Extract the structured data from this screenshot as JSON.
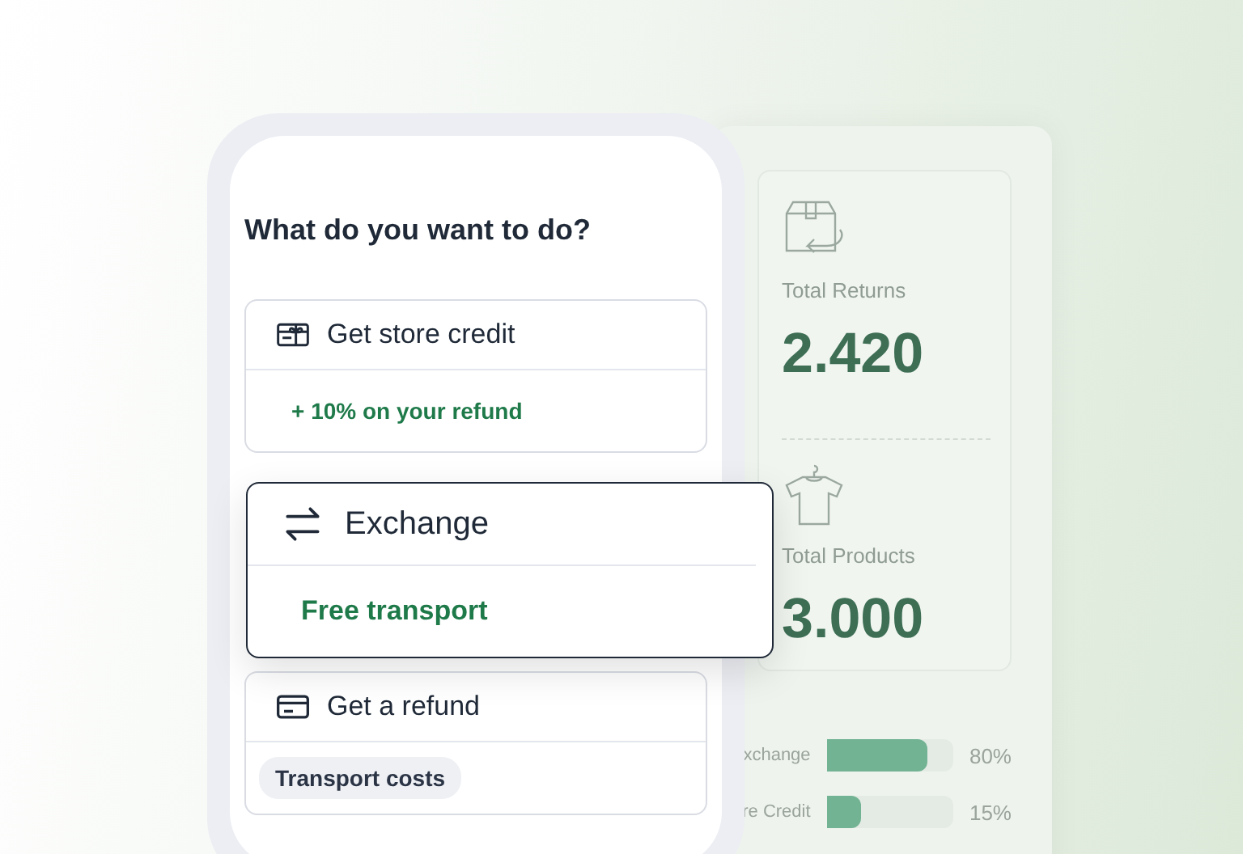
{
  "dashboard": {
    "stats": [
      {
        "kind": "returns",
        "label": "Total Returns",
        "value": "2.420"
      },
      {
        "kind": "products",
        "label": "Total Products",
        "value": "3.000"
      }
    ],
    "breakdown": [
      {
        "label": "xchange",
        "level": 0.8,
        "reading": "80%"
      },
      {
        "label": "re Credit",
        "level": 0.27,
        "reading": "15%"
      }
    ]
  },
  "phone": {
    "title": "What do you want to do?",
    "options": [
      {
        "kind": "store-credit",
        "label": "Get store credit",
        "note": "+ 10% on your refund",
        "highlighted": false
      },
      {
        "kind": "exchange",
        "label": "Exchange",
        "note": "Free transport",
        "highlighted": true
      },
      {
        "kind": "refund",
        "label": "Get a refund",
        "tag": "Transport costs",
        "highlighted": false
      }
    ]
  }
}
